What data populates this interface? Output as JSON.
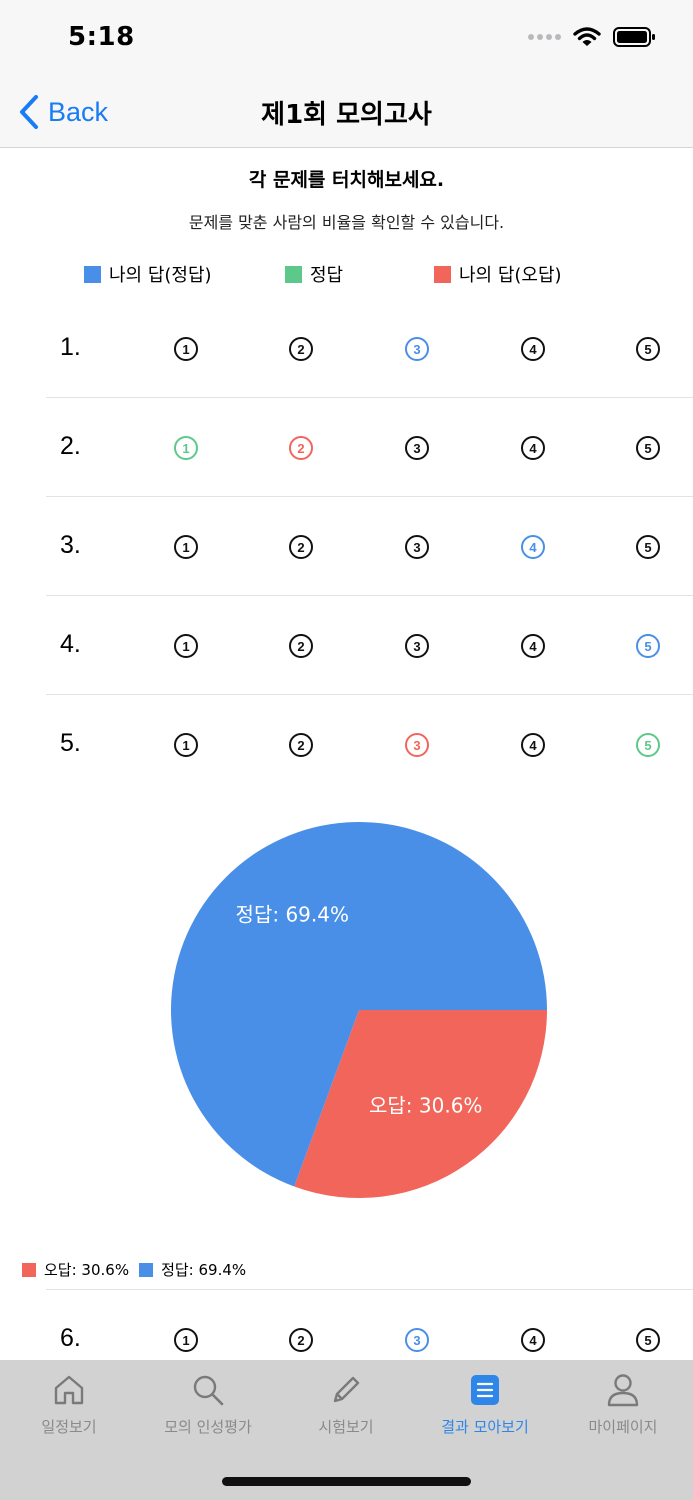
{
  "status_bar": {
    "time": "5:18"
  },
  "nav": {
    "back_label": "Back",
    "title": "제1회 모의고사"
  },
  "instructions": {
    "title": "각 문제를 터치해보세요.",
    "subtitle": "문제를 맞춘 사람의 비율을 확인할 수 있습니다."
  },
  "legend": [
    {
      "label": "나의 답(정답)",
      "color": "#4a8fe7"
    },
    {
      "label": "정답",
      "color": "#5cc98a"
    },
    {
      "label": "나의 답(오답)",
      "color": "#f2655a"
    }
  ],
  "questions": [
    {
      "number": "1.",
      "options": [
        {
          "glyph": "1",
          "state": "black"
        },
        {
          "glyph": "2",
          "state": "black"
        },
        {
          "glyph": "3",
          "state": "blue"
        },
        {
          "glyph": "4",
          "state": "black"
        },
        {
          "glyph": "5",
          "state": "black"
        }
      ]
    },
    {
      "number": "2.",
      "options": [
        {
          "glyph": "1",
          "state": "green"
        },
        {
          "glyph": "2",
          "state": "red"
        },
        {
          "glyph": "3",
          "state": "black"
        },
        {
          "glyph": "4",
          "state": "black"
        },
        {
          "glyph": "5",
          "state": "black"
        }
      ]
    },
    {
      "number": "3.",
      "options": [
        {
          "glyph": "1",
          "state": "black"
        },
        {
          "glyph": "2",
          "state": "black"
        },
        {
          "glyph": "3",
          "state": "black"
        },
        {
          "glyph": "4",
          "state": "blue"
        },
        {
          "glyph": "5",
          "state": "black"
        }
      ]
    },
    {
      "number": "4.",
      "options": [
        {
          "glyph": "1",
          "state": "black"
        },
        {
          "glyph": "2",
          "state": "black"
        },
        {
          "glyph": "3",
          "state": "black"
        },
        {
          "glyph": "4",
          "state": "black"
        },
        {
          "glyph": "5",
          "state": "blue"
        }
      ]
    },
    {
      "number": "5.",
      "options": [
        {
          "glyph": "1",
          "state": "black"
        },
        {
          "glyph": "2",
          "state": "black"
        },
        {
          "glyph": "3",
          "state": "red"
        },
        {
          "glyph": "4",
          "state": "black"
        },
        {
          "glyph": "5",
          "state": "green"
        }
      ]
    },
    {
      "number": "6.",
      "options": [
        {
          "glyph": "1",
          "state": "black"
        },
        {
          "glyph": "2",
          "state": "black"
        },
        {
          "glyph": "3",
          "state": "blue"
        },
        {
          "glyph": "4",
          "state": "black"
        },
        {
          "glyph": "5",
          "state": "black"
        }
      ]
    }
  ],
  "chart_data": {
    "type": "pie",
    "slices": [
      {
        "name": "정답",
        "value": 69.4,
        "label": "정답: 69.4%",
        "color": "#4a8fe7"
      },
      {
        "name": "오답",
        "value": 30.6,
        "label": "오답: 30.6%",
        "color": "#f2655a"
      }
    ],
    "legend": [
      {
        "label": "오답: 30.6%",
        "color": "#f2655a"
      },
      {
        "label": "정답: 69.4%",
        "color": "#4a8fe7"
      }
    ],
    "legend_position": "bottom-left"
  },
  "tabs": [
    {
      "label": "일정보기",
      "icon": "home-icon",
      "active": false
    },
    {
      "label": "모의 인성평가",
      "icon": "search-icon",
      "active": false
    },
    {
      "label": "시험보기",
      "icon": "pencil-icon",
      "active": false
    },
    {
      "label": "결과 모아보기",
      "icon": "list-document-icon",
      "active": true
    },
    {
      "label": "마이페이지",
      "icon": "person-icon",
      "active": false
    }
  ],
  "colors": {
    "accent": "#2e86e8",
    "back_blue": "#1a7cf5",
    "tab_bar_bg": "#d2d2d2"
  }
}
